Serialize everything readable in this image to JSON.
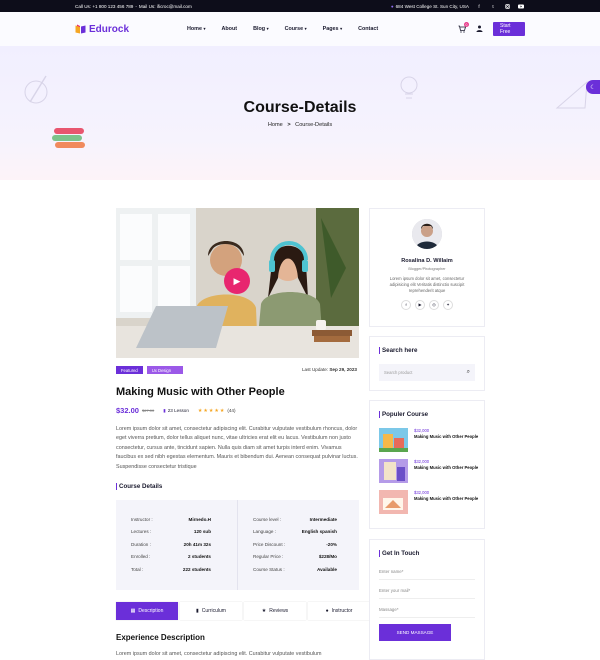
{
  "topbar": {
    "call": "Call Us: +1 800 123 456 789",
    "mail": "Mail Us: ificroc@mail.com",
    "address": "684 West College St. Sun City, USA",
    "social": [
      "f",
      "t",
      "in",
      "yt"
    ]
  },
  "header": {
    "brand": "Edurock",
    "nav": [
      "Home",
      "About",
      "Blog",
      "Course",
      "Pages",
      "Contact"
    ],
    "cart_count": "0",
    "cta": "Start Free"
  },
  "hero": {
    "title": "Course-Details",
    "crumb_home": "Home",
    "crumb_sep": ">",
    "crumb_current": "Course-Details"
  },
  "course": {
    "tag1": "Featured",
    "tag2": "Ux Design",
    "last_update_label": "Last Update:",
    "last_update": "Sep 29, 2023",
    "title": "Making Music with Other People",
    "price": "$32.00",
    "old_price": "$67.00",
    "lessons": "23 Lesson",
    "rating": 5,
    "reviews": "(44)",
    "description": "Lorem ipsum dolor sit amet, consectetur adipiscing elit. Curabitur vulputate vestibulum rhoncus, dolor eget viverra pretium, dolor tellus aliquet nunc, vitae ultricies erat elit eu lacus. Vestibulum non justo consectetur, cursus ante, tincidunt sapien. Nulla quis diam sit amet turpis interd enim. Vivamus faucibus ex sed nibh egestas elementum. Mauris et bibendum dui. Aenean consequat pulvinar luctus. Suspendisse consectetur tristique"
  },
  "details": {
    "heading": "Course Details",
    "left": [
      {
        "label": "Instructor :",
        "value": "Mirnedo.H"
      },
      {
        "label": "Lectures :",
        "value": "120 sub"
      },
      {
        "label": "Duration :",
        "value": "20h 41m 32s"
      },
      {
        "label": "Enrolled :",
        "value": "2 students"
      },
      {
        "label": "Total :",
        "value": "222 students"
      }
    ],
    "right": [
      {
        "label": "Course level :",
        "value": "Intermediate"
      },
      {
        "label": "Language :",
        "value": "English spanish"
      },
      {
        "label": "Price Discount :",
        "value": "-20%"
      },
      {
        "label": "Regular Price :",
        "value": "$228/Mo"
      },
      {
        "label": "Course Status :",
        "value": "Available"
      }
    ]
  },
  "tabs": [
    "Description",
    "Curriculum",
    "Reviews",
    "Instructor"
  ],
  "experience": {
    "title": "Experience Description",
    "text": "Lorem ipsum dolor sit amet, consectetur adipiscing elit. Curabitur vulputate vestibulum"
  },
  "author": {
    "name": "Rosalina D. Willaim",
    "role": "Blogger/Photographer",
    "bio": "Lorem ipsum dolor sit amet, consectetur adipisicing elit Veritatis distinctio suscipit reprehenderit atque",
    "social": [
      "f",
      "yt",
      "ig",
      "tw"
    ]
  },
  "search": {
    "heading": "Search here",
    "placeholder": "Search product"
  },
  "popular": {
    "heading": "Populer Course",
    "items": [
      {
        "price": "$32,000",
        "name": "Making Music with Other People"
      },
      {
        "price": "$32,000",
        "name": "Making Music with Other People"
      },
      {
        "price": "$32,000",
        "name": "Making Music with Other People"
      }
    ]
  },
  "contact": {
    "heading": "Get In Touch",
    "name": "Enter name*",
    "email": "Enter your mail*",
    "message": "Massage*",
    "button": "SEND MASSAGE"
  },
  "colors": {
    "accent": "#6b2fd9",
    "pink": "#e8266f",
    "star": "#f5a623"
  }
}
